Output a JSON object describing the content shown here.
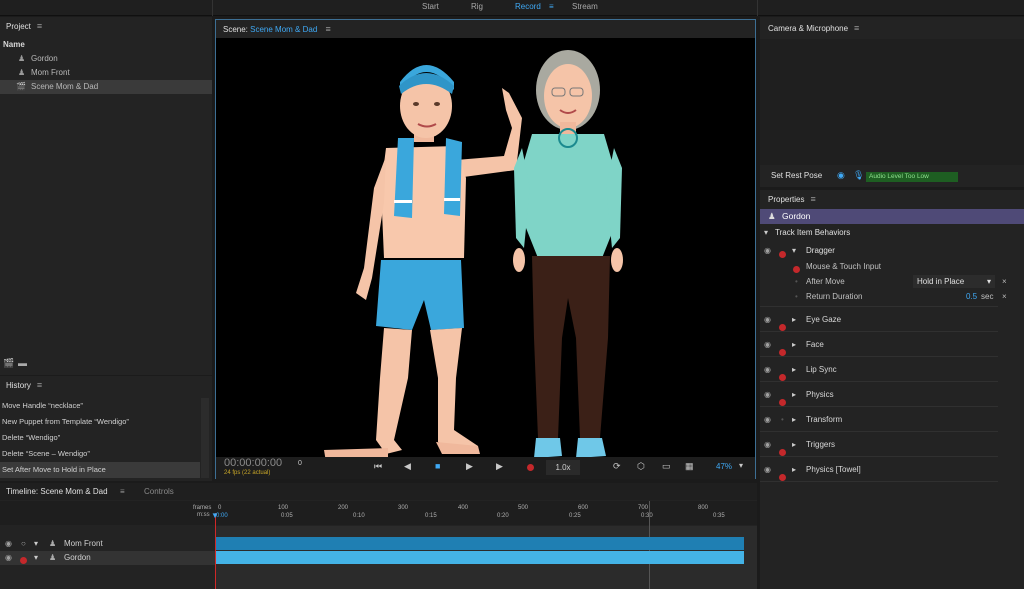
{
  "workspace": {
    "tabs": [
      "Start",
      "Rig",
      "Record",
      "Stream"
    ],
    "active_tab": "Record",
    "accent_color": "#3fa9f5"
  },
  "project": {
    "title": "Project",
    "column_name": "Name",
    "items": [
      {
        "label": "Gordon",
        "icon": "puppet-icon"
      },
      {
        "label": "Mom Front",
        "icon": "puppet-icon"
      },
      {
        "label": "Scene Mom & Dad",
        "icon": "clapperboard-icon"
      }
    ]
  },
  "history": {
    "title": "History",
    "items": [
      "Move Handle “necklace”",
      "New Puppet from Template “Wendigo”",
      "Delete “Wendigo”",
      "Delete “Scene – Wendigo”",
      "Set After Move to Hold in Place"
    ]
  },
  "scene": {
    "title_prefix": "Scene:",
    "title_name": "Scene Mom & Dad",
    "timecode": "00:00:00:00",
    "frame": "0",
    "fps": "24 fps (22 actual)",
    "speed": "1.0x",
    "zoom": "47%"
  },
  "camera": {
    "title": "Camera & Microphone",
    "set_rest_pose": "Set Rest Pose",
    "audio_level": "Audio Level Too Low"
  },
  "properties": {
    "title": "Properties",
    "puppet": "Gordon",
    "section": "Track Item Behaviors",
    "dragger": {
      "label": "Dragger",
      "input": "Mouse & Touch Input",
      "after_move_label": "After Move",
      "after_move_value": "Hold in Place",
      "return_label": "Return Duration",
      "return_value": "0.5",
      "return_unit": "sec"
    },
    "behaviors": [
      "Eye Gaze",
      "Face",
      "Lip Sync",
      "Physics",
      "Transform",
      "Triggers",
      "Physics [Towel]"
    ]
  },
  "timeline": {
    "title": "Timeline: Scene Mom & Dad",
    "controls_tab": "Controls",
    "frames_label": "frames",
    "mmss_label": "m:ss",
    "frame_ticks": [
      "0",
      "100",
      "200",
      "300",
      "400",
      "500",
      "600",
      "700",
      "800"
    ],
    "time_ticks": [
      "0:00",
      "0:05",
      "0:10",
      "0:15",
      "0:20",
      "0:25",
      "0:30",
      "0:35"
    ],
    "layers": [
      "Mom Front",
      "Gordon"
    ]
  }
}
